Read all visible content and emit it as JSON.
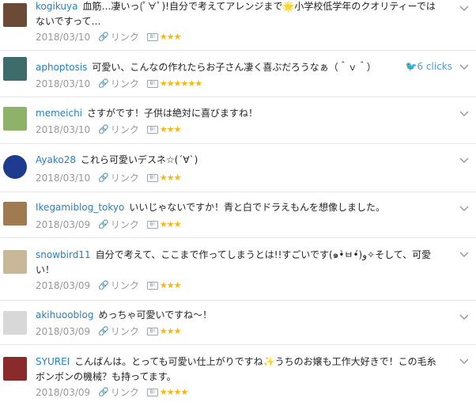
{
  "comments": [
    {
      "user": "kogikuya",
      "text": "血筋…凄いっ(ﾟ∀ﾟ)!自分で考えてアレンジまで🌟小学校低学年のクオリティーではないですって…",
      "date": "2018/03/10",
      "link": "リンク",
      "stars": "★★★",
      "avatar_color": "#6b4a36"
    },
    {
      "user": "aphoptosis",
      "text": "可愛い、こんなの作れたらお子さん凄く喜ぶだろうなぁ（＾ｖ＾）",
      "date": "2018/03/10",
      "link": "リンク",
      "stars": "★★★★★★",
      "avatar_color": "#3e6c6a",
      "clicks": "6 clicks"
    },
    {
      "user": "memeichi",
      "text": "さすがです！子供は絶対に喜びますね！",
      "date": "2018/03/10",
      "link": "リンク",
      "stars": "★★★",
      "avatar_color": "#8fb26a"
    },
    {
      "user": "Ayako28",
      "text": "これら可愛いデスネ☆(´∀`)",
      "date": "2018/03/10",
      "link": "リンク",
      "stars": "★★★",
      "avatar_color": "#1d3c8f"
    },
    {
      "user": "Ikegamiblog_tokyo",
      "text": "いいじゃないですか！青と白でドラえもんを想像しました。",
      "date": "2018/03/09",
      "link": "リンク",
      "stars": "★★★",
      "avatar_color": "#a07b4f"
    },
    {
      "user": "snowbird11",
      "text": "自分で考えて、ここまで作ってしまうとは!!すごいです(๑•̀ㅂ•́)و✧そして、可愛い！",
      "date": "2018/03/09",
      "link": "リンク",
      "stars": "★★★",
      "avatar_color": "#c9b79a"
    },
    {
      "user": "akihuooblog",
      "text": "めっちゃ可愛いですね～！",
      "date": "2018/03/09",
      "link": "リンク",
      "stars": "★★★",
      "avatar_color": "#d8d8d8"
    },
    {
      "user": "SYUREI",
      "text": "こんばんは。とっても可愛い仕上がりですね✨うちのお嬢も工作大好きで！この毛糸ボンボンの機械？も持ってます。",
      "date": "2018/03/09",
      "link": "リンク",
      "stars": "★★★★",
      "avatar_color": "#8a2a2a"
    }
  ],
  "icons": {
    "link": "link-icon",
    "bookmark": "bookmark-icon",
    "chevron": "chevron-down-icon",
    "twitter": "twitter-icon"
  },
  "colors": {
    "username": "#2a7fbd",
    "star": "#f5b80c",
    "meta": "#999999"
  }
}
